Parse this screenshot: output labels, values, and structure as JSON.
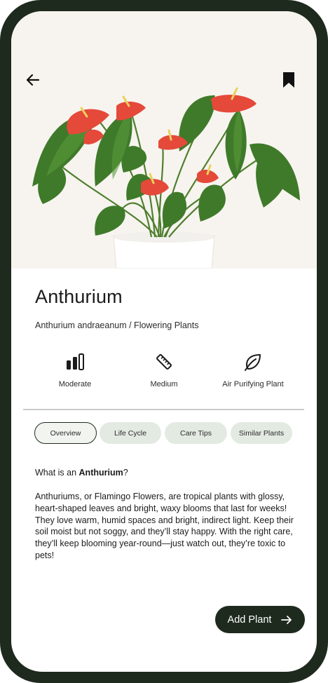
{
  "plant": {
    "name": "Anthurium",
    "subtitle": "Anthurium andraeanum / Flowering Plants"
  },
  "features": [
    {
      "icon": "difficulty-bars-icon",
      "label": "Moderate"
    },
    {
      "icon": "ruler-icon",
      "label": "Medium"
    },
    {
      "icon": "leaf-icon",
      "label": "Air Purifying Plant"
    }
  ],
  "tabs": [
    {
      "label": "Overview",
      "active": true
    },
    {
      "label": "Life Cycle",
      "active": false
    },
    {
      "label": "Care Tips",
      "active": false
    },
    {
      "label": "Similar Plants",
      "active": false
    }
  ],
  "about": {
    "prefix": "What is an ",
    "name": "Anthurium",
    "suffix": "?",
    "body": "Anthuriums, or Flamingo Flowers, are tropical plants with glossy, heart-shaped leaves and bright, waxy blooms that last for weeks! They love warm, humid spaces and bright, indirect light. Keep their soil moist but not soggy, and they’ll stay happy. With the right care, they’ll keep blooming year-round—just watch out, they’re toxic to pets!"
  },
  "actions": {
    "add_label": "Add Plant"
  },
  "colors": {
    "frame": "#1f2a1f",
    "tab_bg": "#e3eae2",
    "accent_dark": "#1f2a1f",
    "flower_red": "#e5493a",
    "leaf_green": "#3f7a2a"
  }
}
